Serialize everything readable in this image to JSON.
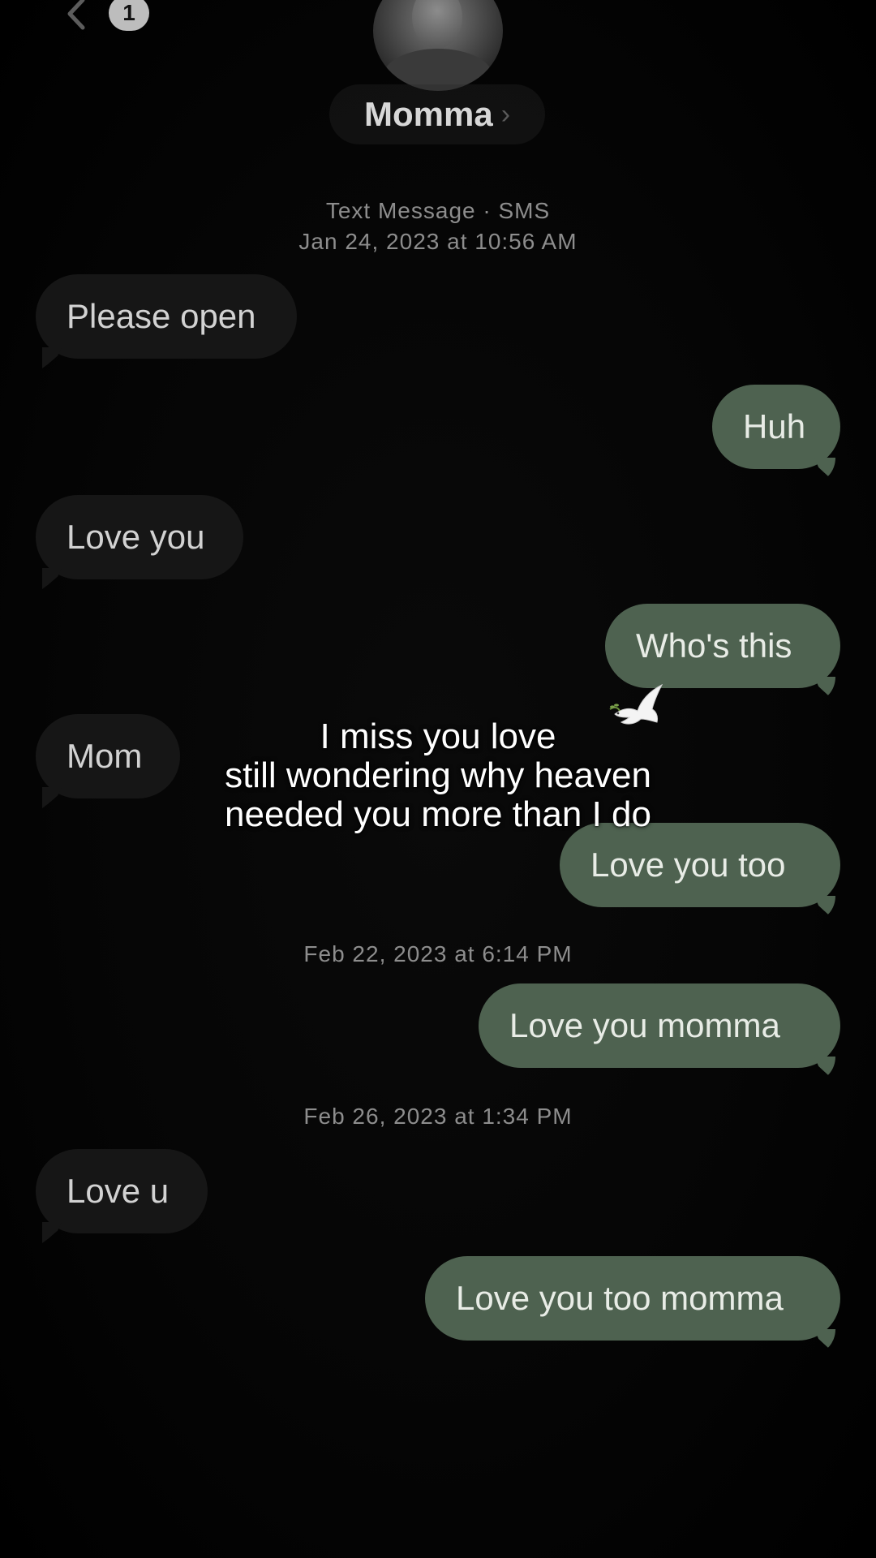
{
  "header": {
    "back_icon": "chevron-left-icon",
    "unread_count": "1",
    "contact_name": "Momma",
    "contact_chevron": "›"
  },
  "thread_info": {
    "type_label": "Text Message · SMS",
    "first_timestamp": "Jan 24, 2023 at 10:56 AM"
  },
  "messages": [
    {
      "direction": "in",
      "text": "Please open"
    },
    {
      "direction": "out",
      "text": "Huh"
    },
    {
      "direction": "in",
      "text": "Love you"
    },
    {
      "direction": "out",
      "text": "Who's this"
    },
    {
      "direction": "in",
      "text": "Mom"
    },
    {
      "direction": "out",
      "text": "Love you too"
    },
    {
      "direction": "out",
      "text": "Love you momma"
    },
    {
      "direction": "in",
      "text": "Love u"
    },
    {
      "direction": "out",
      "text": "Love you too momma"
    }
  ],
  "timestamps": {
    "second": "Feb 22, 2023 at 6:14 PM",
    "third": "Feb 26, 2023 at 1:34 PM"
  },
  "overlay": {
    "line1": "I miss you love",
    "line2": "still wondering why heaven",
    "line3": "needed you more than I do",
    "emoji": "dove-icon"
  },
  "colors": {
    "background": "#000000",
    "incoming_bubble": "#161616",
    "outgoing_bubble": "#4e6250"
  }
}
